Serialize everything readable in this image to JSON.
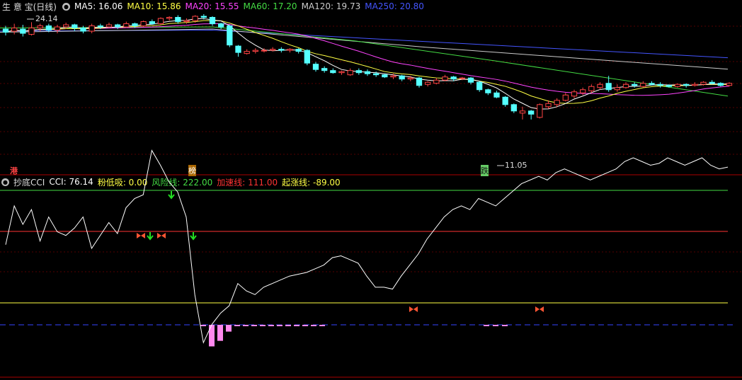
{
  "top": {
    "stock": "生 意 宝(日线)",
    "ma": [
      {
        "label": "MA5: 16.06",
        "color": "#ffffff"
      },
      {
        "label": "MA10: 15.86",
        "color": "#ffff44"
      },
      {
        "label": "MA20: 15.55",
        "color": "#ff44ff"
      },
      {
        "label": "MA60: 17.20",
        "color": "#44dd44"
      },
      {
        "label": "MA120: 19.73",
        "color": "#cccccc"
      },
      {
        "label": "MA250: 20.80",
        "color": "#4455ff"
      }
    ],
    "high_label": "24.14",
    "low_label": "11.05",
    "marks": {
      "left": "港",
      "mid": "榜",
      "low": "跌"
    }
  },
  "bottom": {
    "title": "抄底CCI",
    "items": [
      {
        "label": "CCI: 76.14",
        "color": "#ffffff"
      },
      {
        "label": "粉低吸: 0.00",
        "color": "#ffff44"
      },
      {
        "label": "风险线: 222.00",
        "color": "#44dd44"
      },
      {
        "label": "加速线: 111.00",
        "color": "#ff3333"
      },
      {
        "label": "起涨线: -89.00",
        "color": "#ffff44"
      }
    ]
  },
  "colors": {
    "up": "#ff4444",
    "down": "#55ffff",
    "bg": "#000000",
    "grid": "#880000"
  },
  "candles": [
    [
      23.5,
      23.2,
      23.8,
      22.9
    ],
    [
      23.3,
      23.6,
      24.0,
      23.0
    ],
    [
      23.5,
      23.1,
      23.9,
      22.8
    ],
    [
      23.0,
      23.6,
      24.14,
      22.9
    ],
    [
      23.6,
      23.8,
      24.0,
      23.3
    ],
    [
      23.8,
      23.4,
      24.0,
      23.2
    ],
    [
      23.4,
      23.7,
      23.9,
      23.1
    ],
    [
      23.7,
      23.9,
      24.1,
      23.5
    ],
    [
      23.9,
      23.6,
      24.0,
      23.3
    ],
    [
      23.6,
      23.3,
      23.8,
      23.1
    ],
    [
      23.3,
      23.8,
      24.0,
      23.1
    ],
    [
      23.8,
      23.7,
      24.0,
      23.5
    ],
    [
      23.7,
      23.9,
      24.1,
      23.6
    ],
    [
      23.9,
      23.7,
      24.0,
      23.5
    ],
    [
      23.7,
      24.0,
      24.2,
      23.6
    ],
    [
      24.0,
      23.8,
      24.1,
      23.6
    ],
    [
      23.8,
      24.2,
      24.3,
      23.7
    ],
    [
      24.2,
      24.0,
      24.4,
      23.9
    ],
    [
      24.0,
      24.5,
      24.6,
      23.9
    ],
    [
      24.5,
      24.6,
      24.7,
      24.3
    ],
    [
      24.6,
      24.2,
      24.8,
      24.0
    ],
    [
      24.2,
      24.3,
      24.5,
      24.0
    ],
    [
      24.3,
      24.7,
      24.8,
      24.1
    ],
    [
      24.7,
      24.6,
      24.9,
      24.4
    ],
    [
      24.6,
      24.0,
      24.7,
      23.8
    ],
    [
      24.0,
      23.7,
      24.1,
      23.5
    ],
    [
      23.8,
      22.0,
      23.9,
      21.8
    ],
    [
      21.9,
      21.3,
      22.0,
      20.9
    ],
    [
      21.2,
      21.4,
      21.6,
      21.1
    ],
    [
      21.4,
      21.5,
      21.7,
      21.2
    ],
    [
      21.5,
      21.5,
      21.7,
      21.3
    ],
    [
      21.5,
      21.6,
      21.8,
      21.4
    ],
    [
      21.6,
      21.5,
      21.8,
      21.3
    ],
    [
      21.5,
      21.6,
      21.7,
      21.3
    ],
    [
      21.6,
      21.4,
      21.7,
      21.2
    ],
    [
      21.5,
      20.3,
      21.6,
      20.1
    ],
    [
      20.2,
      19.7,
      20.4,
      19.5
    ],
    [
      19.8,
      19.6,
      20.0,
      19.4
    ],
    [
      19.6,
      19.4,
      19.8,
      19.3
    ],
    [
      19.4,
      19.5,
      19.6,
      19.2
    ],
    [
      19.2,
      19.6,
      19.8,
      19.1
    ],
    [
      19.6,
      19.4,
      19.8,
      19.2
    ],
    [
      19.5,
      19.3,
      19.7,
      19.1
    ],
    [
      19.3,
      19.2,
      19.5,
      19.0
    ],
    [
      19.2,
      19.0,
      19.3,
      18.9
    ],
    [
      19.0,
      19.1,
      19.3,
      18.8
    ],
    [
      19.1,
      18.8,
      19.2,
      18.6
    ],
    [
      18.8,
      18.9,
      19.1,
      18.6
    ],
    [
      18.9,
      18.2,
      19.0,
      18.0
    ],
    [
      18.3,
      18.5,
      18.6,
      18.1
    ],
    [
      18.4,
      18.7,
      18.9,
      18.3
    ],
    [
      18.7,
      19.0,
      19.2,
      18.6
    ],
    [
      19.0,
      18.8,
      19.1,
      18.6
    ],
    [
      18.9,
      18.9,
      19.0,
      18.7
    ],
    [
      18.9,
      18.5,
      19.0,
      18.3
    ],
    [
      18.5,
      17.8,
      18.6,
      17.6
    ],
    [
      17.8,
      17.5,
      17.9,
      17.3
    ],
    [
      17.5,
      17.1,
      17.7,
      17.0
    ],
    [
      17.1,
      16.4,
      17.2,
      16.2
    ],
    [
      16.4,
      15.8,
      16.5,
      15.6
    ],
    [
      15.6,
      15.8,
      16.2,
      15.0
    ],
    [
      15.8,
      15.5,
      15.9,
      15.0
    ],
    [
      15.2,
      16.4,
      16.5,
      15.1
    ],
    [
      16.2,
      16.5,
      16.8,
      16.0
    ],
    [
      16.4,
      16.8,
      17.0,
      16.2
    ],
    [
      16.8,
      17.3,
      17.5,
      16.7
    ],
    [
      17.2,
      17.6,
      17.8,
      17.0
    ],
    [
      17.5,
      17.8,
      18.0,
      17.3
    ],
    [
      17.7,
      18.1,
      18.3,
      17.5
    ],
    [
      18.0,
      18.3,
      18.5,
      17.8
    ],
    [
      18.4,
      17.8,
      19.1,
      17.6
    ],
    [
      17.8,
      18.0,
      18.3,
      17.6
    ],
    [
      18.0,
      18.3,
      18.5,
      17.9
    ],
    [
      18.3,
      18.2,
      18.5,
      18.0
    ],
    [
      18.1,
      18.4,
      18.6,
      18.0
    ],
    [
      18.4,
      18.3,
      18.6,
      18.2
    ],
    [
      18.3,
      18.2,
      18.5,
      18.0
    ],
    [
      18.2,
      18.1,
      18.3,
      18.0
    ],
    [
      18.1,
      18.3,
      18.4,
      18.0
    ],
    [
      18.3,
      18.2,
      18.4,
      18.0
    ],
    [
      18.2,
      18.3,
      18.5,
      18.1
    ],
    [
      18.3,
      18.5,
      18.6,
      18.2
    ],
    [
      18.5,
      18.4,
      18.7,
      18.3
    ],
    [
      18.4,
      18.2,
      18.5,
      18.1
    ],
    [
      18.2,
      18.4,
      18.5,
      18.1
    ]
  ],
  "cci": [
    75,
    180,
    130,
    170,
    85,
    150,
    110,
    100,
    120,
    150,
    65,
    100,
    135,
    105,
    175,
    200,
    210,
    330,
    290,
    245,
    218,
    150,
    -60,
    -190,
    -140,
    -110,
    -90,
    -30,
    -50,
    -60,
    -40,
    -30,
    -20,
    -10,
    -5,
    0,
    10,
    20,
    40,
    45,
    35,
    25,
    -10,
    -40,
    -40,
    -45,
    -10,
    20,
    50,
    90,
    120,
    150,
    170,
    180,
    170,
    200,
    190,
    180,
    200,
    220,
    240,
    250,
    260,
    250,
    270,
    280,
    270,
    260,
    250,
    260,
    270,
    280,
    300,
    310,
    300,
    290,
    295,
    310,
    300,
    290,
    300,
    310,
    290,
    280,
    285
  ],
  "pink": [
    -90,
    -200,
    -185,
    -160,
    -135,
    -120,
    -130,
    -145,
    -135,
    -120,
    -115,
    -110,
    -115,
    -112,
    -105
  ],
  "pink2": [
    -110,
    -115,
    -112
  ]
}
